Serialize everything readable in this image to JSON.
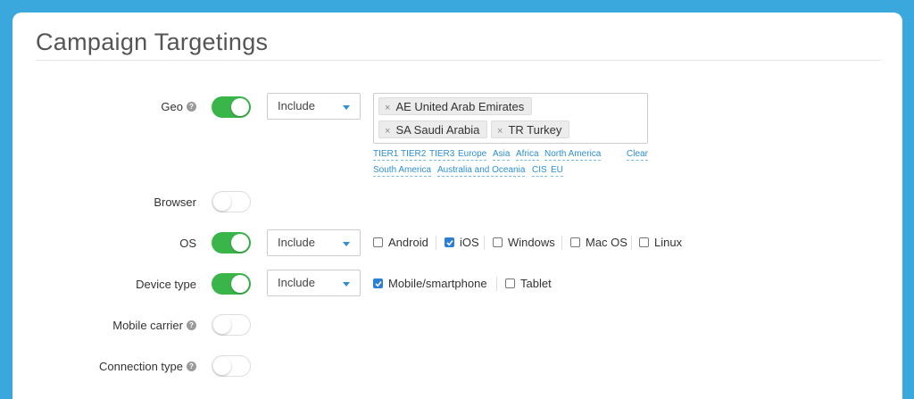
{
  "page": {
    "title": "Campaign Targetings"
  },
  "geo": {
    "label": "Geo",
    "mode": "Include",
    "tags": [
      "AE United Arab Emirates",
      "SA Saudi Arabia",
      "TR Turkey"
    ],
    "quick_links": [
      "TIER1",
      "TIER2",
      "TIER3",
      "Europe",
      "Asia",
      "Africa",
      "North America",
      "South America",
      "Australia and Oceania",
      "CIS",
      "EU"
    ],
    "clear_label": "Clear"
  },
  "browser": {
    "label": "Browser"
  },
  "os": {
    "label": "OS",
    "mode": "Include",
    "options": [
      {
        "label": "Android",
        "checked": false
      },
      {
        "label": "iOS",
        "checked": true
      },
      {
        "label": "Windows",
        "checked": false
      },
      {
        "label": "Mac OS",
        "checked": false
      },
      {
        "label": "Linux",
        "checked": false
      }
    ]
  },
  "device_type": {
    "label": "Device type",
    "mode": "Include",
    "options": [
      {
        "label": "Mobile/smartphone",
        "checked": true
      },
      {
        "label": "Tablet",
        "checked": false
      }
    ]
  },
  "mobile_carrier": {
    "label": "Mobile carrier"
  },
  "connection_type": {
    "label": "Connection type"
  },
  "help_glyph": "?",
  "remove_glyph": "×",
  "colors": {
    "accent": "#2d8fd5",
    "toggle_on": "#3ab54a",
    "background": "#3aa8dc"
  }
}
